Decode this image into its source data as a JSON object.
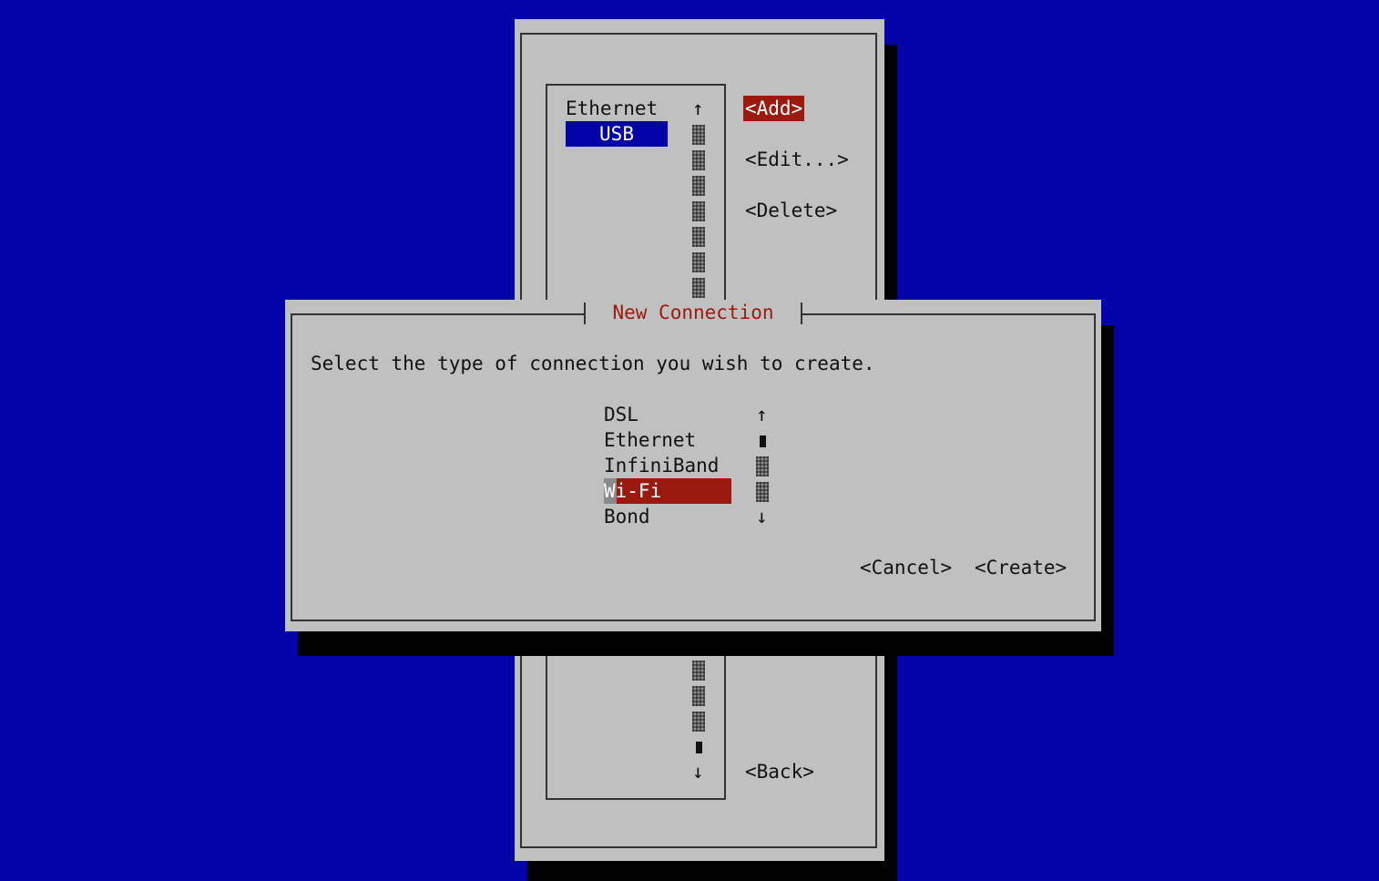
{
  "back_window": {
    "list_items": [
      "Ethernet",
      "USB"
    ],
    "selected_index": 1,
    "buttons": {
      "add": "<Add>",
      "edit": "<Edit...>",
      "delete": "<Delete>",
      "back": "<Back>"
    },
    "scroll_up": "↑",
    "scroll_down": "↓"
  },
  "dialog": {
    "title": "New Connection",
    "prompt": "Select the type of connection you wish to create.",
    "types": [
      "DSL",
      "Ethernet",
      "InfiniBand",
      "Wi-Fi",
      "Bond"
    ],
    "selected_index": 3,
    "scroll_up": "↑",
    "scroll_down": "↓",
    "buttons": {
      "cancel": "<Cancel>",
      "create": "<Create>"
    }
  },
  "colors": {
    "background": "#0303a8",
    "window": "#c0c0c0",
    "accent": "#9b1a10",
    "selection_blue": "#0303a8"
  }
}
